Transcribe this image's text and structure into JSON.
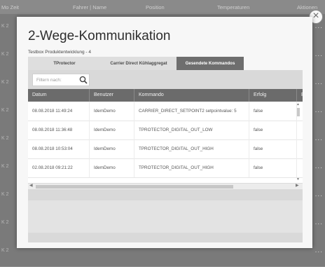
{
  "background": {
    "columns": [
      "Mo Zeit",
      "Fahrer | Name",
      "Position",
      "Temperaturen",
      "Aktionen"
    ],
    "row_prefix": "K 2",
    "row_action": "...",
    "row_count": 9
  },
  "modal": {
    "title": "2-Wege-Kommunikation",
    "subtitle": "Testbox Produktentwicklung - 4",
    "close_glyph": "×",
    "tabs": [
      {
        "label": "TProtector",
        "active": false
      },
      {
        "label": "Carrier Direct Kühlaggregat",
        "active": false
      },
      {
        "label": "Gesendete Kommandos",
        "active": true
      }
    ],
    "filter": {
      "placeholder": "Filtern nach:",
      "value": "",
      "icon": "search-icon"
    },
    "table": {
      "columns": [
        "Datum",
        "Benutzer",
        "Kommando",
        "Erfolg",
        "Er"
      ],
      "rows": [
        [
          "08.08.2018 11:49:24",
          "IdemDemo",
          "CARRIER_DIRECT_SETPOINT2 setpointvalue: 5",
          "false"
        ],
        [
          "08.08.2018 11:36:48",
          "IdemDemo",
          "TPROTECTOR_DIGITAL_OUT_LOW",
          "false"
        ],
        [
          "08.08.2018 10:53:04",
          "IdemDemo",
          "TPROTECTOR_DIGITAL_OUT_HIGH",
          "false"
        ],
        [
          "02.08.2018 09:21:22",
          "IdemDemo",
          "TPROTECTOR_DIGITAL_OUT_HIGH",
          "false"
        ]
      ]
    },
    "scroll": {
      "up": "▲",
      "down": "▼",
      "left": "◀",
      "right": "▶"
    }
  },
  "colors": {
    "header_dark": "#6b6b6b",
    "active_tab": "#6e6e6e",
    "overlay": "#7d7d7d"
  }
}
